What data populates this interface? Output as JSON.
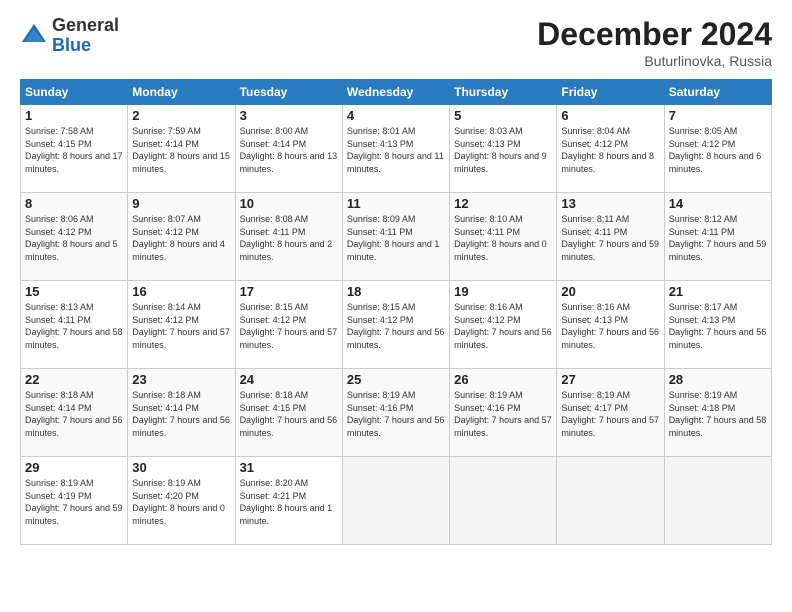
{
  "logo": {
    "general": "General",
    "blue": "Blue"
  },
  "title": "December 2024",
  "subtitle": "Buturlinovka, Russia",
  "days_header": [
    "Sunday",
    "Monday",
    "Tuesday",
    "Wednesday",
    "Thursday",
    "Friday",
    "Saturday"
  ],
  "weeks": [
    [
      {
        "day": "1",
        "sunrise": "7:58 AM",
        "sunset": "4:15 PM",
        "daylight": "8 hours and 17 minutes."
      },
      {
        "day": "2",
        "sunrise": "7:59 AM",
        "sunset": "4:14 PM",
        "daylight": "8 hours and 15 minutes."
      },
      {
        "day": "3",
        "sunrise": "8:00 AM",
        "sunset": "4:14 PM",
        "daylight": "8 hours and 13 minutes."
      },
      {
        "day": "4",
        "sunrise": "8:01 AM",
        "sunset": "4:13 PM",
        "daylight": "8 hours and 11 minutes."
      },
      {
        "day": "5",
        "sunrise": "8:03 AM",
        "sunset": "4:13 PM",
        "daylight": "8 hours and 9 minutes."
      },
      {
        "day": "6",
        "sunrise": "8:04 AM",
        "sunset": "4:12 PM",
        "daylight": "8 hours and 8 minutes."
      },
      {
        "day": "7",
        "sunrise": "8:05 AM",
        "sunset": "4:12 PM",
        "daylight": "8 hours and 6 minutes."
      }
    ],
    [
      {
        "day": "8",
        "sunrise": "8:06 AM",
        "sunset": "4:12 PM",
        "daylight": "8 hours and 5 minutes."
      },
      {
        "day": "9",
        "sunrise": "8:07 AM",
        "sunset": "4:12 PM",
        "daylight": "8 hours and 4 minutes."
      },
      {
        "day": "10",
        "sunrise": "8:08 AM",
        "sunset": "4:11 PM",
        "daylight": "8 hours and 2 minutes."
      },
      {
        "day": "11",
        "sunrise": "8:09 AM",
        "sunset": "4:11 PM",
        "daylight": "8 hours and 1 minute."
      },
      {
        "day": "12",
        "sunrise": "8:10 AM",
        "sunset": "4:11 PM",
        "daylight": "8 hours and 0 minutes."
      },
      {
        "day": "13",
        "sunrise": "8:11 AM",
        "sunset": "4:11 PM",
        "daylight": "7 hours and 59 minutes."
      },
      {
        "day": "14",
        "sunrise": "8:12 AM",
        "sunset": "4:11 PM",
        "daylight": "7 hours and 59 minutes."
      }
    ],
    [
      {
        "day": "15",
        "sunrise": "8:13 AM",
        "sunset": "4:11 PM",
        "daylight": "7 hours and 58 minutes."
      },
      {
        "day": "16",
        "sunrise": "8:14 AM",
        "sunset": "4:12 PM",
        "daylight": "7 hours and 57 minutes."
      },
      {
        "day": "17",
        "sunrise": "8:15 AM",
        "sunset": "4:12 PM",
        "daylight": "7 hours and 57 minutes."
      },
      {
        "day": "18",
        "sunrise": "8:15 AM",
        "sunset": "4:12 PM",
        "daylight": "7 hours and 56 minutes."
      },
      {
        "day": "19",
        "sunrise": "8:16 AM",
        "sunset": "4:12 PM",
        "daylight": "7 hours and 56 minutes."
      },
      {
        "day": "20",
        "sunrise": "8:16 AM",
        "sunset": "4:13 PM",
        "daylight": "7 hours and 56 minutes."
      },
      {
        "day": "21",
        "sunrise": "8:17 AM",
        "sunset": "4:13 PM",
        "daylight": "7 hours and 56 minutes."
      }
    ],
    [
      {
        "day": "22",
        "sunrise": "8:18 AM",
        "sunset": "4:14 PM",
        "daylight": "7 hours and 56 minutes."
      },
      {
        "day": "23",
        "sunrise": "8:18 AM",
        "sunset": "4:14 PM",
        "daylight": "7 hours and 56 minutes."
      },
      {
        "day": "24",
        "sunrise": "8:18 AM",
        "sunset": "4:15 PM",
        "daylight": "7 hours and 56 minutes."
      },
      {
        "day": "25",
        "sunrise": "8:19 AM",
        "sunset": "4:16 PM",
        "daylight": "7 hours and 56 minutes."
      },
      {
        "day": "26",
        "sunrise": "8:19 AM",
        "sunset": "4:16 PM",
        "daylight": "7 hours and 57 minutes."
      },
      {
        "day": "27",
        "sunrise": "8:19 AM",
        "sunset": "4:17 PM",
        "daylight": "7 hours and 57 minutes."
      },
      {
        "day": "28",
        "sunrise": "8:19 AM",
        "sunset": "4:18 PM",
        "daylight": "7 hours and 58 minutes."
      }
    ],
    [
      {
        "day": "29",
        "sunrise": "8:19 AM",
        "sunset": "4:19 PM",
        "daylight": "7 hours and 59 minutes."
      },
      {
        "day": "30",
        "sunrise": "8:19 AM",
        "sunset": "4:20 PM",
        "daylight": "8 hours and 0 minutes."
      },
      {
        "day": "31",
        "sunrise": "8:20 AM",
        "sunset": "4:21 PM",
        "daylight": "8 hours and 1 minute."
      },
      null,
      null,
      null,
      null
    ]
  ]
}
